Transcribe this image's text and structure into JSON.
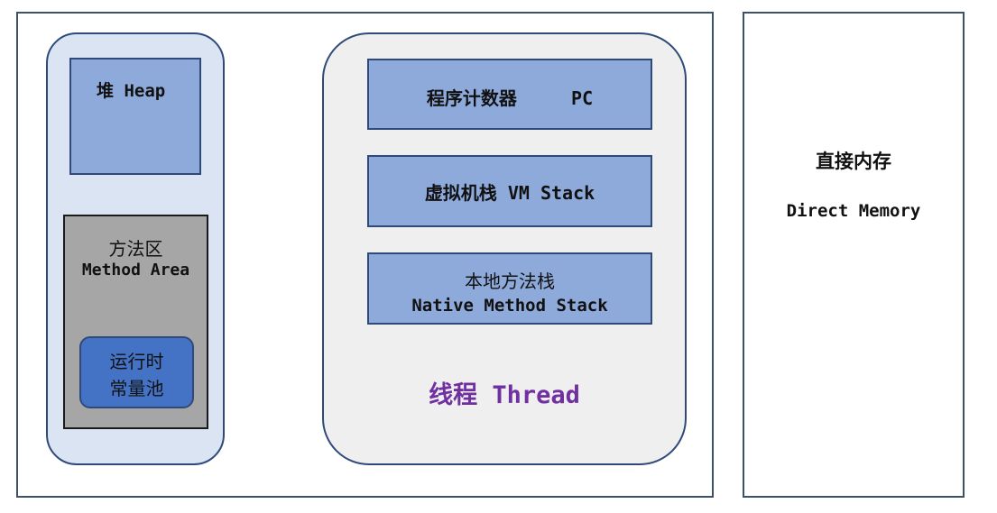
{
  "heap": {
    "label": "堆 Heap"
  },
  "method_area": {
    "line1": "方法区",
    "line2": "Method Area"
  },
  "runtime_constant_pool": {
    "line1": "运行时",
    "line2": "常量池"
  },
  "program_counter": {
    "label": "程序计数器     PC"
  },
  "vm_stack": {
    "label": "虚拟机栈 VM Stack"
  },
  "native_method_stack": {
    "line1": "本地方法栈",
    "line2": "Native Method Stack"
  },
  "thread": {
    "label": "线程 Thread",
    "color": "#7030a0"
  },
  "direct_memory": {
    "line1": "直接内存",
    "line2": "Direct Memory"
  },
  "colors": {
    "blue_box": "#8eaadb",
    "border": "#2f4a7a",
    "method_area": "#a6a6a6",
    "pool": "#4472c4"
  }
}
